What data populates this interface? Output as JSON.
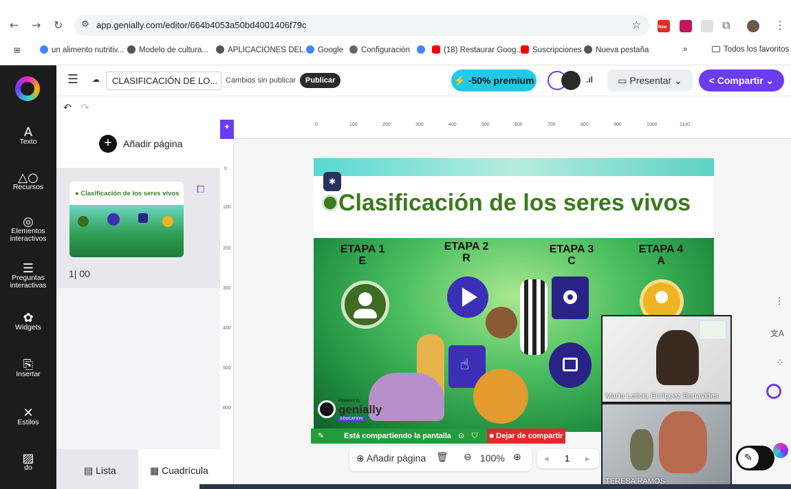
{
  "browser": {
    "url": "app.genially.com/editor/664b4053a50bd4001406f79c",
    "bookmarks": [
      "un alimento nutritiv...",
      "Modelo de cultura...",
      "APLICACIONES DEL...",
      "Google",
      "Configuración",
      "(18) Restaurar Goog...",
      "Suscripciones",
      "Nueva pestaña"
    ],
    "all_favorites": "Todos los favoritos",
    "ext_badge": "New"
  },
  "rail": {
    "items": [
      "Texto",
      "Recursos",
      "Elementos interactivos",
      "Preguntas interactivas",
      "Widgets",
      "Insertar",
      "Estilos",
      "do"
    ]
  },
  "header": {
    "doc_title": "CLASIFICACIÓN DE LO...",
    "status": "Cambios sin publicar",
    "publish": "Publicar",
    "premium": "-50% premium",
    "present": "Presentar",
    "share": "Compartir"
  },
  "pages": {
    "add_page": "Añadir página",
    "thumb_title": "Clasificación de los seres vivos",
    "page_label": "1| 00",
    "list": "Lista",
    "grid": "Cuadrícula"
  },
  "ruler": {
    "top": [
      "0",
      "100",
      "200",
      "300",
      "400",
      "500",
      "600",
      "700",
      "800",
      "900",
      "1000",
      "1100"
    ],
    "left": [
      "0",
      "100",
      "200",
      "300",
      "400",
      "500",
      "600"
    ]
  },
  "slide": {
    "title": "Clasificación de los seres vivos",
    "stages": [
      {
        "name": "ETAPA 1",
        "letter": "E"
      },
      {
        "name": "ETAPA 2",
        "letter": "R"
      },
      {
        "name": "ETAPA 3",
        "letter": "C"
      },
      {
        "name": "ETAPA 4",
        "letter": "A"
      }
    ],
    "powered_by": "Powered by",
    "brand": "genially",
    "edition": "EDUCATION"
  },
  "sharing": {
    "message": "Está compartiendo la pantalla",
    "stop": "Dejar de compartir"
  },
  "bottom_bar": {
    "add_page": "Añadir página",
    "zoom": "100%",
    "page": "1"
  },
  "participants": [
    {
      "name": "María Leticia Enríquez Benavides"
    },
    {
      "name": "TERESA RAMOS"
    }
  ],
  "colors": {
    "premium": "#22c9e6",
    "share": "#6b3cf0",
    "title_green": "#3b7a1e",
    "share_bar": "#239d3b",
    "stop": "#e02a2a"
  }
}
